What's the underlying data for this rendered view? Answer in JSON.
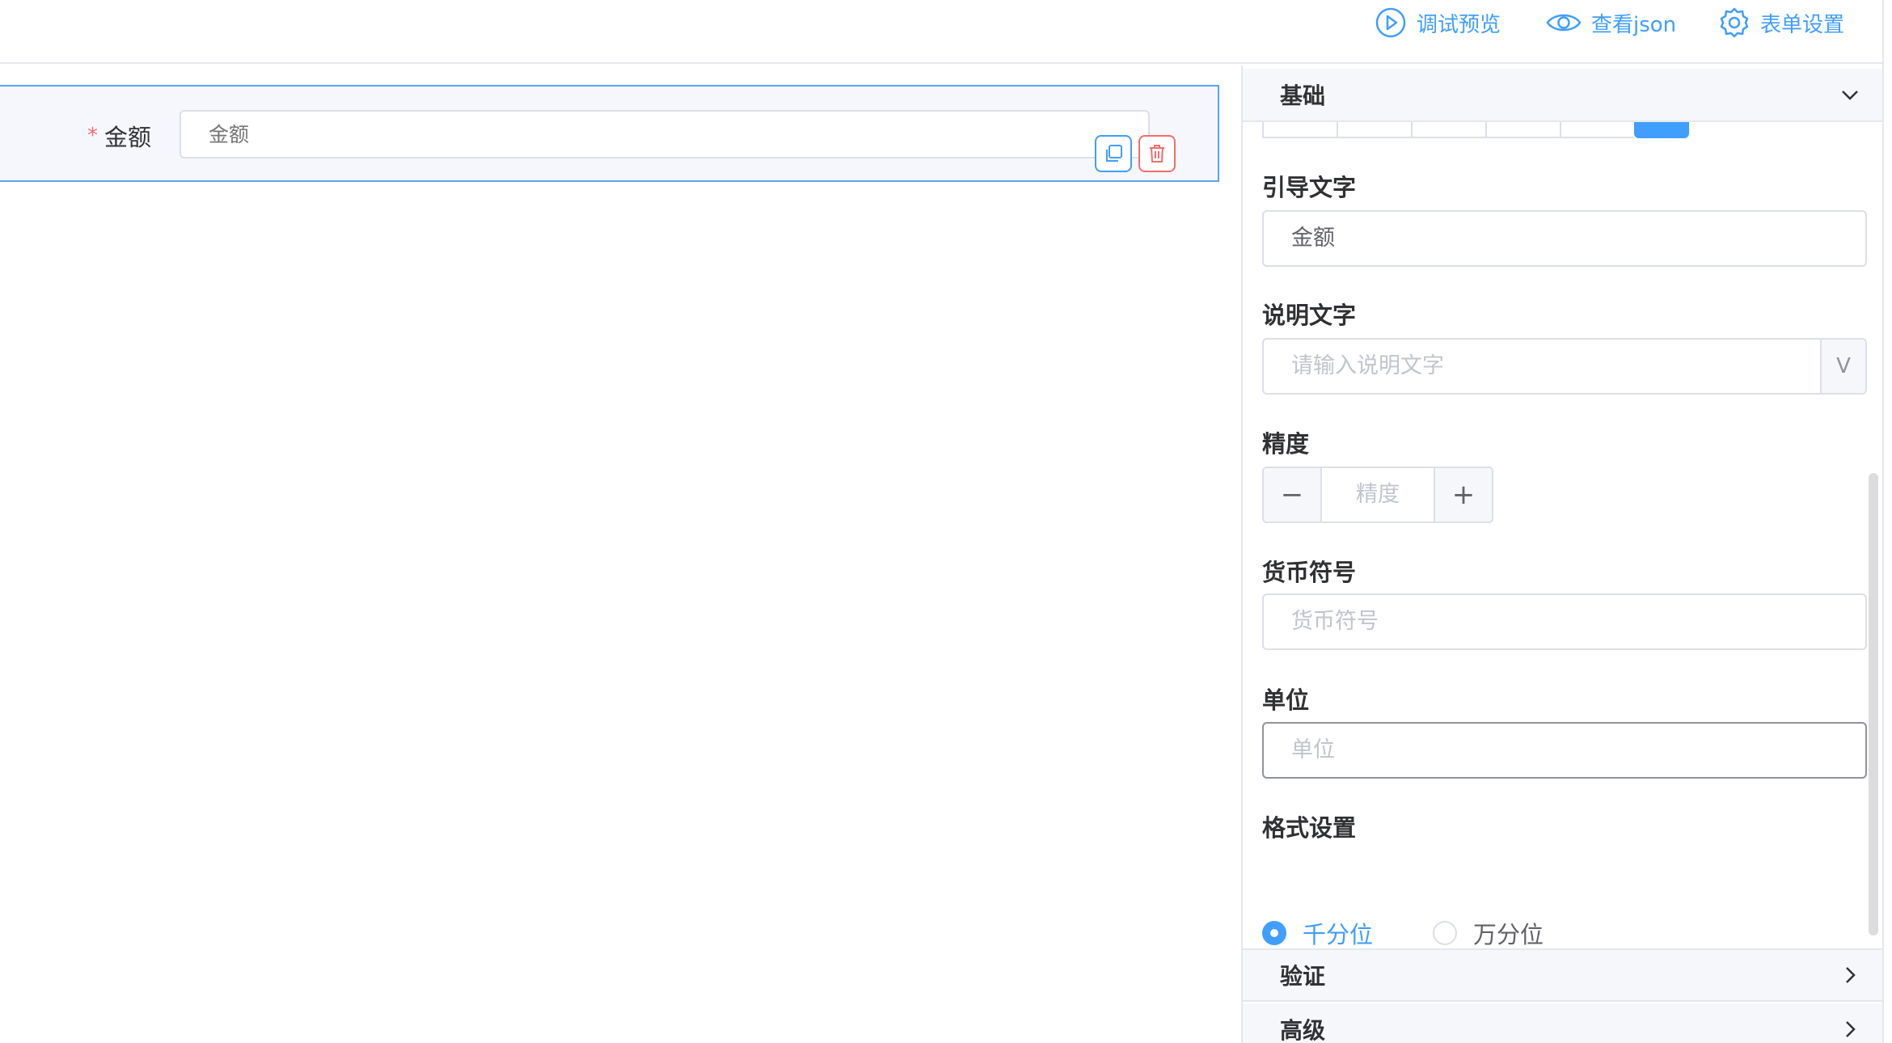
{
  "toolbar": {
    "preview_label": "调试预览",
    "json_label": "查看json",
    "settings_label": "表单设置"
  },
  "canvas": {
    "field": {
      "required_mark": "*",
      "label": "金额",
      "placeholder": "金额"
    }
  },
  "panel": {
    "sections": {
      "basic": "基础",
      "verify": "验证",
      "advanced": "高级"
    },
    "guide_text": {
      "label": "引导文字",
      "value": "金额"
    },
    "desc_text": {
      "label": "说明文字",
      "placeholder": "请输入说明文字",
      "append": "V"
    },
    "precision": {
      "label": "精度",
      "placeholder": "精度",
      "minus": "−",
      "plus": "+"
    },
    "currency": {
      "label": "货币符号",
      "placeholder": "货币符号"
    },
    "unit": {
      "label": "单位",
      "placeholder": "单位"
    },
    "format": {
      "label": "格式设置",
      "options": [
        {
          "label": "千分位",
          "checked": true
        },
        {
          "label": "万分位",
          "checked": false
        }
      ]
    }
  },
  "colors": {
    "primary": "#409eff",
    "danger": "#f56c6c",
    "border": "#dcdfe6"
  }
}
